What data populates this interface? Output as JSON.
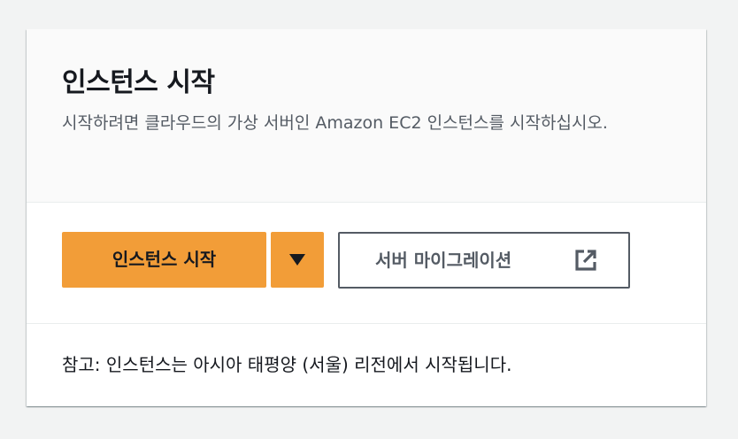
{
  "card": {
    "title": "인스턴스 시작",
    "description": "시작하려면 클라우드의 가상 서버인 Amazon EC2 인스턴스를 시작하십시오.",
    "primary_button_label": "인스턴스 시작",
    "dropdown_icon": "caret-down-icon",
    "secondary_button_label": "서버 마이그레이션",
    "secondary_button_icon": "external-link-icon",
    "footer_note": "참고: 인스턴스는 아시아 태평양 (서울) 리전에서 시작됩니다."
  },
  "colors": {
    "primary": "#f29d38",
    "text_dark": "#16191f",
    "text_secondary": "#545b64",
    "header_bg": "#fafafa",
    "page_bg": "#f2f3f3"
  }
}
